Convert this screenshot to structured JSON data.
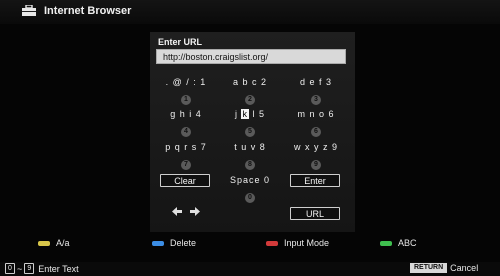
{
  "header": {
    "title": "Internet Browser",
    "icon": "toolbox-icon"
  },
  "url": {
    "label": "Enter URL",
    "value": "http://boston.craigslist.org/"
  },
  "keypad": [
    {
      "chars": ". @ / : 1",
      "num": "1"
    },
    {
      "chars": "a b c 2",
      "num": "2"
    },
    {
      "chars": "d e f 3",
      "num": "3"
    },
    {
      "chars": "g h i 4",
      "num": "4"
    },
    {
      "chars_pre": "j ",
      "chars_hl": "k",
      "chars_post": " l 5",
      "num": "5"
    },
    {
      "chars": "m n o 6",
      "num": "6"
    },
    {
      "chars": "p q r s 7",
      "num": "7"
    },
    {
      "chars": "t u v 8",
      "num": "8"
    },
    {
      "chars": "w x y z 9",
      "num": "9"
    },
    {
      "chars": "Space 0",
      "num": "0"
    }
  ],
  "buttons": {
    "clear": "Clear",
    "enter": "Enter",
    "url": "URL"
  },
  "arrows": {
    "left": "◆",
    "right": "◆"
  },
  "legend": [
    {
      "color": "#d8c64a",
      "label": "A/a"
    },
    {
      "color": "#3c8ee6",
      "label": "Delete"
    },
    {
      "color": "#d23a3a",
      "label": "Input Mode"
    },
    {
      "color": "#3fbf4f",
      "label": "ABC"
    }
  ],
  "footer": {
    "num_from": "0",
    "tilde": "~",
    "num_to": "9",
    "enter_text": "Enter Text",
    "return_label": "RETURN",
    "cancel_label": "Cancel"
  }
}
